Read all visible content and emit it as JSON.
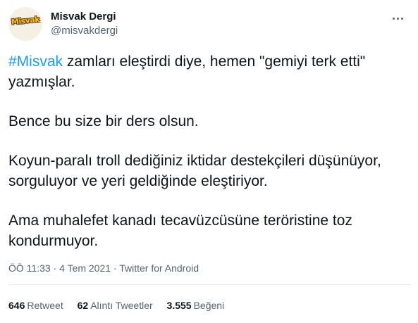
{
  "author": {
    "display_name": "Misvak Dergi",
    "handle": "@misvakdergi",
    "avatar_text": "Misvak"
  },
  "tweet": {
    "hashtag": "#Misvak",
    "line1_rest": " zamları eleştirdi diye, hemen \"gemiyi terk etti\" yazmışlar.",
    "p2": "Bence bu size bir ders olsun.",
    "p3": "Koyun-paralı troll dediğiniz iktidar destekçileri düşünüyor, sorguluyor ve yeri geldiğinde eleştiriyor.",
    "p4": "Ama muhalefet kanadı tecavüzcüsüne teröristine  toz kondurmuyor."
  },
  "meta": {
    "text": "ÖÖ 11:33 · 4 Tem 2021 · Twitter for Android"
  },
  "stats": {
    "retweets_count": "646",
    "retweets_label": "Retweet",
    "quotes_count": "62",
    "quotes_label": "Alıntı Tweetler",
    "likes_count": "3.555",
    "likes_label": "Beğeni"
  },
  "icons": {
    "more": "more-horizontal-icon"
  },
  "colors": {
    "link": "#1d9bf0",
    "secondary_text": "#536471",
    "primary_text": "#0f1419"
  }
}
